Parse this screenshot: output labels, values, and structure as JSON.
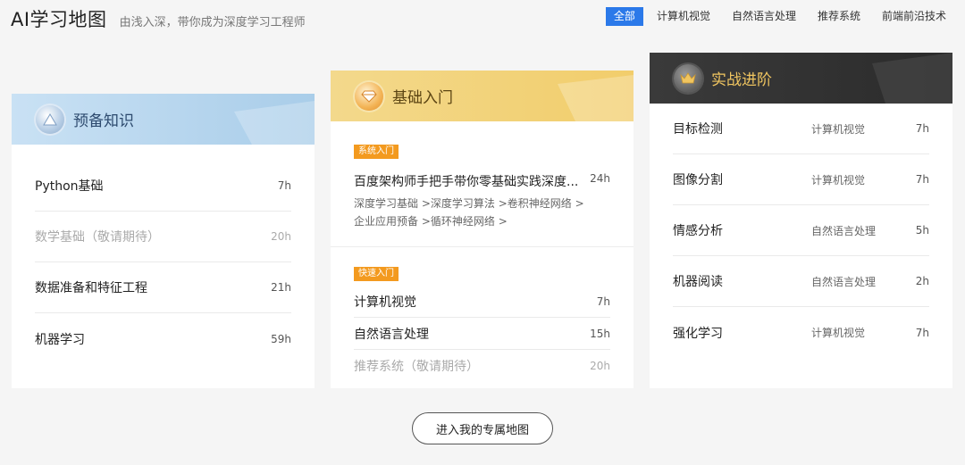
{
  "header": {
    "title": "AI学习地图",
    "subtitle": "由浅入深，带你成为深度学习工程师"
  },
  "filters": [
    {
      "label": "全部",
      "active": true
    },
    {
      "label": "计算机视觉",
      "active": false
    },
    {
      "label": "自然语言处理",
      "active": false
    },
    {
      "label": "推荐系统",
      "active": false
    },
    {
      "label": "前端前沿技术",
      "active": false
    }
  ],
  "cards": {
    "basics": {
      "title": "预备知识",
      "items": [
        {
          "name": "Python基础",
          "hours": "7h",
          "muted": false
        },
        {
          "name": "数学基础（敬请期待）",
          "hours": "20h",
          "muted": true
        },
        {
          "name": "数据准备和特征工程",
          "hours": "21h",
          "muted": false
        },
        {
          "name": "机器学习",
          "hours": "59h",
          "muted": false
        }
      ]
    },
    "intro": {
      "title": "基础入门",
      "system_tag": "系统入门",
      "system_course": {
        "name": "百度架构师手把手带你零基础实践深度...",
        "hours": "24h",
        "topics_line1": [
          "深度学习基础 >",
          "深度学习算法 >",
          "卷积神经网络 >"
        ],
        "topics_line2": [
          "企业应用预备 >",
          "循环神经网络 >"
        ]
      },
      "quick_tag": "快速入门",
      "quick_items": [
        {
          "name": "计算机视觉",
          "hours": "7h",
          "muted": false
        },
        {
          "name": "自然语言处理",
          "hours": "15h",
          "muted": false
        },
        {
          "name": "推荐系统（敬请期待）",
          "hours": "20h",
          "muted": true
        }
      ]
    },
    "advanced": {
      "title": "实战进阶",
      "items": [
        {
          "name": "目标检测",
          "category": "计算机视觉",
          "hours": "7h"
        },
        {
          "name": "图像分割",
          "category": "计算机视觉",
          "hours": "7h"
        },
        {
          "name": "情感分析",
          "category": "自然语言处理",
          "hours": "5h"
        },
        {
          "name": "机器阅读",
          "category": "自然语言处理",
          "hours": "2h"
        },
        {
          "name": "强化学习",
          "category": "计算机视觉",
          "hours": "7h"
        }
      ]
    }
  },
  "cta": {
    "label": "进入我的专属地图"
  },
  "icons": {
    "basics_badge": "triangle-icon",
    "intro_badge": "diamond-icon",
    "advanced_badge": "crown-icon"
  },
  "colors": {
    "accent": "#2b79e9",
    "tag": "#f39a1f",
    "advanced_title": "#f0c560"
  }
}
